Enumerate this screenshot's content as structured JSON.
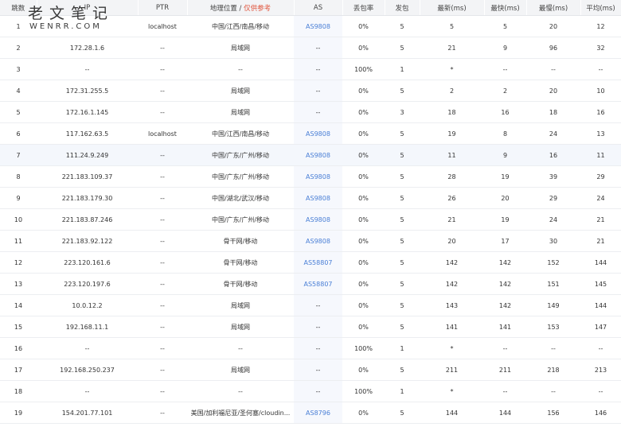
{
  "header": {
    "hop": "跳数",
    "ip": "IP",
    "ptr": "PTR",
    "geo": "地理位置 /",
    "geo_note": "仅供参考",
    "as": "AS",
    "loss": "丢包率",
    "sent": "发包",
    "last": "最新(ms)",
    "best": "最快(ms)",
    "worst": "最慢(ms)",
    "avg": "平均(ms)"
  },
  "watermark": {
    "title": "老文笔记",
    "subtitle": "WENRR.COM"
  },
  "rows": [
    {
      "hop": "1",
      "ip": "",
      "ptr": "localhost",
      "geo": "中国/江西/南昌/移动",
      "as": "AS9808",
      "loss": "0%",
      "sent": "5",
      "last": "5",
      "best": "5",
      "worst": "20",
      "avg": "12"
    },
    {
      "hop": "2",
      "ip": "172.28.1.6",
      "ptr": "--",
      "geo": "局域网",
      "as": "--",
      "loss": "0%",
      "sent": "5",
      "last": "21",
      "best": "9",
      "worst": "96",
      "avg": "32"
    },
    {
      "hop": "3",
      "ip": "--",
      "ptr": "--",
      "geo": "--",
      "as": "--",
      "loss": "100%",
      "sent": "1",
      "last": "*",
      "best": "--",
      "worst": "--",
      "avg": "--"
    },
    {
      "hop": "4",
      "ip": "172.31.255.5",
      "ptr": "--",
      "geo": "局域网",
      "as": "--",
      "loss": "0%",
      "sent": "5",
      "last": "2",
      "best": "2",
      "worst": "20",
      "avg": "10"
    },
    {
      "hop": "5",
      "ip": "172.16.1.145",
      "ptr": "--",
      "geo": "局域网",
      "as": "--",
      "loss": "0%",
      "sent": "3",
      "last": "18",
      "best": "16",
      "worst": "18",
      "avg": "16"
    },
    {
      "hop": "6",
      "ip": "117.162.63.5",
      "ptr": "localhost",
      "geo": "中国/江西/南昌/移动",
      "as": "AS9808",
      "loss": "0%",
      "sent": "5",
      "last": "19",
      "best": "8",
      "worst": "24",
      "avg": "13"
    },
    {
      "hop": "7",
      "ip": "111.24.9.249",
      "ptr": "--",
      "geo": "中国/广东/广州/移动",
      "as": "AS9808",
      "loss": "0%",
      "sent": "5",
      "last": "11",
      "best": "9",
      "worst": "16",
      "avg": "11"
    },
    {
      "hop": "8",
      "ip": "221.183.109.37",
      "ptr": "--",
      "geo": "中国/广东/广州/移动",
      "as": "AS9808",
      "loss": "0%",
      "sent": "5",
      "last": "28",
      "best": "19",
      "worst": "39",
      "avg": "29"
    },
    {
      "hop": "9",
      "ip": "221.183.179.30",
      "ptr": "--",
      "geo": "中国/湖北/武汉/移动",
      "as": "AS9808",
      "loss": "0%",
      "sent": "5",
      "last": "26",
      "best": "20",
      "worst": "29",
      "avg": "24"
    },
    {
      "hop": "10",
      "ip": "221.183.87.246",
      "ptr": "--",
      "geo": "中国/广东/广州/移动",
      "as": "AS9808",
      "loss": "0%",
      "sent": "5",
      "last": "21",
      "best": "19",
      "worst": "24",
      "avg": "21"
    },
    {
      "hop": "11",
      "ip": "221.183.92.122",
      "ptr": "--",
      "geo": "骨干网/移动",
      "as": "AS9808",
      "loss": "0%",
      "sent": "5",
      "last": "20",
      "best": "17",
      "worst": "30",
      "avg": "21"
    },
    {
      "hop": "12",
      "ip": "223.120.161.6",
      "ptr": "--",
      "geo": "骨干网/移动",
      "as": "AS58807",
      "loss": "0%",
      "sent": "5",
      "last": "142",
      "best": "142",
      "worst": "152",
      "avg": "144"
    },
    {
      "hop": "13",
      "ip": "223.120.197.6",
      "ptr": "--",
      "geo": "骨干网/移动",
      "as": "AS58807",
      "loss": "0%",
      "sent": "5",
      "last": "142",
      "best": "142",
      "worst": "151",
      "avg": "145"
    },
    {
      "hop": "14",
      "ip": "10.0.12.2",
      "ptr": "--",
      "geo": "局域网",
      "as": "--",
      "loss": "0%",
      "sent": "5",
      "last": "143",
      "best": "142",
      "worst": "149",
      "avg": "144"
    },
    {
      "hop": "15",
      "ip": "192.168.11.1",
      "ptr": "--",
      "geo": "局域网",
      "as": "--",
      "loss": "0%",
      "sent": "5",
      "last": "141",
      "best": "141",
      "worst": "153",
      "avg": "147"
    },
    {
      "hop": "16",
      "ip": "--",
      "ptr": "--",
      "geo": "--",
      "as": "--",
      "loss": "100%",
      "sent": "1",
      "last": "*",
      "best": "--",
      "worst": "--",
      "avg": "--"
    },
    {
      "hop": "17",
      "ip": "192.168.250.237",
      "ptr": "--",
      "geo": "局域网",
      "as": "--",
      "loss": "0%",
      "sent": "5",
      "last": "211",
      "best": "211",
      "worst": "218",
      "avg": "213"
    },
    {
      "hop": "18",
      "ip": "--",
      "ptr": "--",
      "geo": "--",
      "as": "--",
      "loss": "100%",
      "sent": "1",
      "last": "*",
      "best": "--",
      "worst": "--",
      "avg": "--"
    },
    {
      "hop": "19",
      "ip": "154.201.77.101",
      "ptr": "--",
      "geo": "美国/加利福尼亚/圣何塞/cloudin...",
      "as": "AS8796",
      "loss": "0%",
      "sent": "5",
      "last": "144",
      "best": "144",
      "worst": "156",
      "avg": "146"
    }
  ],
  "highlight_row": "7",
  "colors": {
    "as_link": "#4a7fd6",
    "geo_note": "#e0533b",
    "header_bg": "#f3f4f6",
    "highlight_bg": "#f4f7fc"
  }
}
